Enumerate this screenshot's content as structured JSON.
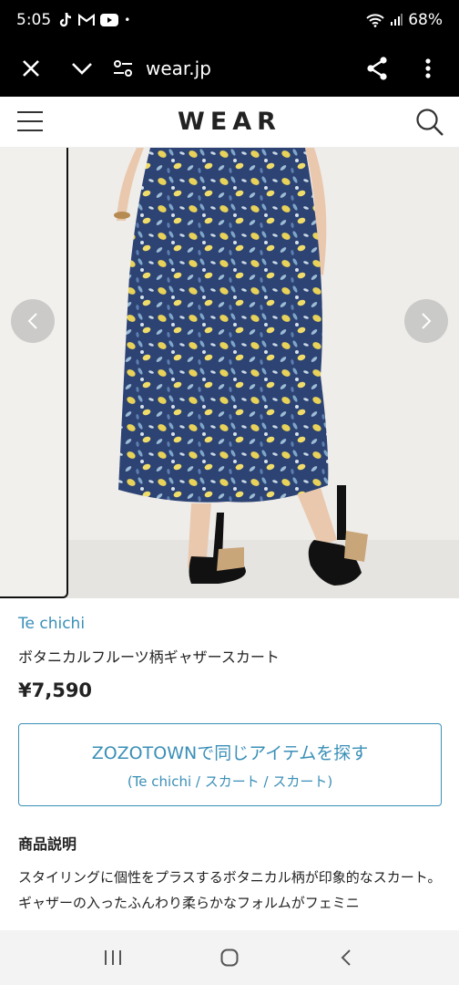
{
  "status_bar": {
    "time": "5:05",
    "battery": "68%",
    "dot": "•"
  },
  "browser": {
    "url": "wear.jp",
    "icons": [
      "close-icon",
      "chevron-down-icon",
      "site-settings-icon",
      "share-icon",
      "more-vert-icon"
    ]
  },
  "site": {
    "logo": "WEAR"
  },
  "product": {
    "brand": "Te chichi",
    "name": "ボタニカルフルーツ柄ギャザースカート",
    "price": "¥7,590",
    "zozo_button": {
      "main": "ZOZOTOWNで同じアイテムを探す",
      "sub": "(Te chichi / スカート / スカート)"
    },
    "description_heading": "商品説明",
    "description": "スタイリングに個性をプラスするボタニカル柄が印象的なスカート。ギャザーの入ったふんわり柔らかなフォルムがフェミニ"
  },
  "colors": {
    "accent": "#3a8fb7",
    "skirt_base": "#2f4a7a",
    "skirt_flower": "#e8d25a"
  }
}
